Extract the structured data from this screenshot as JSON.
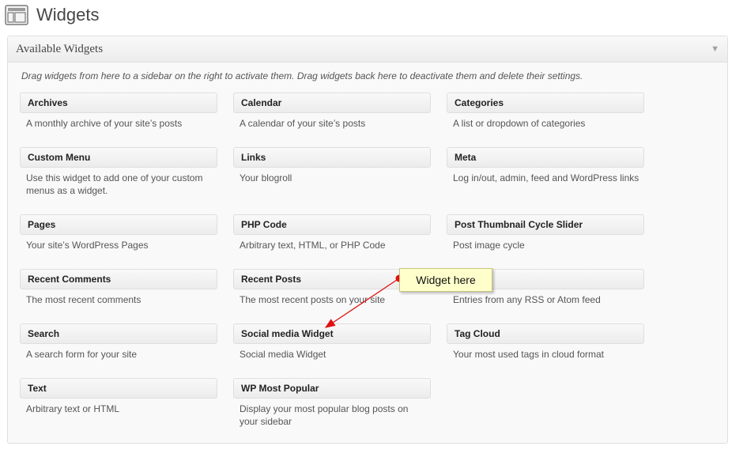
{
  "header": {
    "title": "Widgets",
    "icon": "widgets-layout-icon"
  },
  "panel": {
    "title": "Available Widgets",
    "toggle_icon": "▼",
    "description": "Drag widgets from here to a sidebar on the right to activate them. Drag widgets back here to deactivate them and delete their settings."
  },
  "widgets": [
    {
      "title": "Archives",
      "desc": "A monthly archive of your site’s posts"
    },
    {
      "title": "Calendar",
      "desc": "A calendar of your site’s posts"
    },
    {
      "title": "Categories",
      "desc": "A list or dropdown of categories"
    },
    {
      "title": "Custom Menu",
      "desc": "Use this widget to add one of your custom menus as a widget."
    },
    {
      "title": "Links",
      "desc": "Your blogroll"
    },
    {
      "title": "Meta",
      "desc": "Log in/out, admin, feed and WordPress links"
    },
    {
      "title": "Pages",
      "desc": "Your site’s WordPress Pages"
    },
    {
      "title": "PHP Code",
      "desc": "Arbitrary text, HTML, or PHP Code"
    },
    {
      "title": "Post Thumbnail Cycle Slider",
      "desc": "Post image cycle"
    },
    {
      "title": "Recent Comments",
      "desc": "The most recent comments"
    },
    {
      "title": "Recent Posts",
      "desc": "The most recent posts on your site"
    },
    {
      "title": "",
      "desc": "Entries from any RSS or Atom feed"
    },
    {
      "title": "Search",
      "desc": "A search form for your site"
    },
    {
      "title": "Social media Widget",
      "desc": "Social media Widget"
    },
    {
      "title": "Tag Cloud",
      "desc": "Your most used tags in cloud format"
    },
    {
      "title": "Text",
      "desc": "Arbitrary text or HTML"
    },
    {
      "title": "WP Most Popular",
      "desc": "Display your most popular blog posts on your sidebar"
    }
  ],
  "annotation": {
    "label": "Widget here",
    "arrow_color": "#e01010"
  }
}
